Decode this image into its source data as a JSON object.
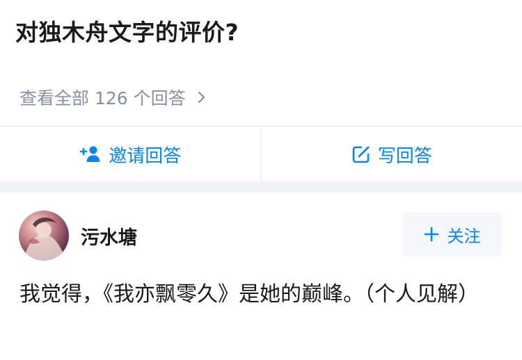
{
  "question": {
    "title": "对独木舟文字的评价?",
    "view_all_label": "查看全部 126 个回答"
  },
  "actions": {
    "invite_label": "邀请回答",
    "write_label": "写回答"
  },
  "answer": {
    "author_name": "污水塘",
    "follow_label": "关注",
    "text": "我觉得，《我亦飘零久》是她的巅峰。（个人见解）"
  },
  "colors": {
    "accent": "#0084ff",
    "muted": "#8590a6",
    "divider": "#e6e6e6",
    "gap": "#f0f2f5"
  }
}
